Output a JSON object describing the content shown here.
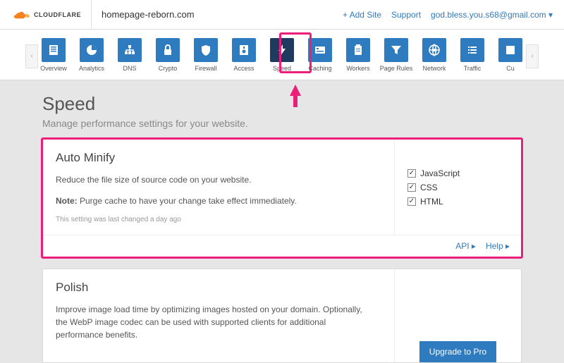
{
  "header": {
    "brand": "CLOUDFLARE",
    "site": "homepage-reborn.com",
    "add_site": "+ Add Site",
    "support": "Support",
    "user": "god.bless.you.s68@gmail.com"
  },
  "nav": {
    "items": [
      {
        "label": "Overview"
      },
      {
        "label": "Analytics"
      },
      {
        "label": "DNS"
      },
      {
        "label": "Crypto"
      },
      {
        "label": "Firewall"
      },
      {
        "label": "Access"
      },
      {
        "label": "Speed"
      },
      {
        "label": "Caching"
      },
      {
        "label": "Workers"
      },
      {
        "label": "Page Rules"
      },
      {
        "label": "Network"
      },
      {
        "label": "Traffic"
      },
      {
        "label": "Cu"
      }
    ]
  },
  "page": {
    "title": "Speed",
    "subtitle": "Manage performance settings for your website."
  },
  "minify": {
    "title": "Auto Minify",
    "desc": "Reduce the file size of source code on your website.",
    "note_label": "Note:",
    "note_text": " Purge cache to have your change take effect immediately.",
    "meta": "This setting was last changed a day ago",
    "opts": {
      "js": "JavaScript",
      "css": "CSS",
      "html": "HTML"
    },
    "api": "API",
    "help": "Help"
  },
  "polish": {
    "title": "Polish",
    "desc": "Improve image load time by optimizing images hosted on your domain. Optionally, the WebP image codec can be used with supported clients for additional performance benefits.",
    "upgrade": "Upgrade to Pro"
  }
}
